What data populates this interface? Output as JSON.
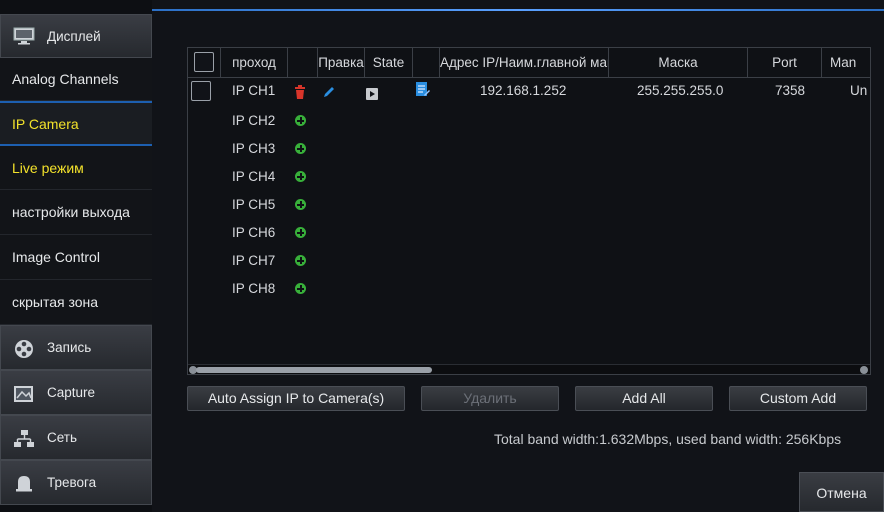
{
  "sidebar": {
    "display": "Дисплей",
    "sub": [
      "Analog Channels",
      "IP Camera",
      "Live режим",
      "настройки выхода",
      "Image Control",
      "скрытая зона"
    ],
    "record": "Запись",
    "capture": "Capture",
    "network": "Сеть",
    "alarm": "Тревога"
  },
  "table": {
    "headers": {
      "channel": "проход",
      "edit": "Правка",
      "state": "State",
      "address": "Адрес IP/Наим.главной маш",
      "mask": "Маска",
      "port": "Port",
      "manufacturer": "Man"
    },
    "row1": {
      "channel": "IP CH1",
      "ip": "192.168.1.252",
      "mask": "255.255.255.0",
      "port": "7358",
      "manufacturer": "Un"
    },
    "empty_rows": [
      "IP CH2",
      "IP CH3",
      "IP CH4",
      "IP CH5",
      "IP CH6",
      "IP CH7",
      "IP CH8"
    ]
  },
  "buttons": {
    "auto_assign": "Auto Assign IP to Camera(s)",
    "delete": "Удалить",
    "add_all": "Add All",
    "custom_add": "Custom Add",
    "cancel": "Отмена"
  },
  "bandwidth": "Total band width:1.632Mbps, used band width: 256Kbps",
  "colors": {
    "accent": "#1d5fb0",
    "highlight": "#f3e22b",
    "add": "#38b03a",
    "delete": "#d8352a",
    "edit": "#2a8ee0"
  },
  "icons": [
    "monitor-icon",
    "film-reel-icon",
    "capture-image-icon",
    "network-icon",
    "alarm-bell-icon",
    "trash-icon",
    "pencil-icon",
    "play-icon",
    "document-edit-icon",
    "add-circle-icon"
  ]
}
